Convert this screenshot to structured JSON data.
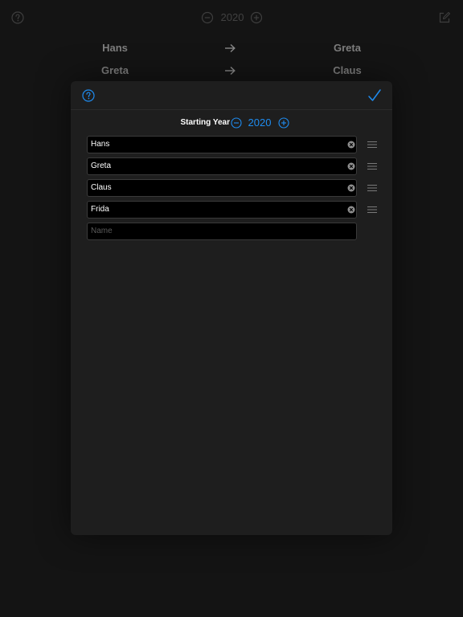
{
  "colors": {
    "accent": "#1e8cf0",
    "sheet_background": "#1e1e1e",
    "field_background": "#000000",
    "dimmed_text": "#7d7d7d"
  },
  "background": {
    "toolbar": {
      "help_icon": "question-circle-icon",
      "decrement_icon": "minus-circle-icon",
      "year": "2020",
      "increment_icon": "plus-circle-icon",
      "edit_icon": "compose-icon"
    },
    "pairs": [
      {
        "giver": "Hans",
        "receiver": "Greta"
      },
      {
        "giver": "Greta",
        "receiver": "Claus"
      }
    ],
    "arrow_icon": "arrow-right-icon"
  },
  "sheet": {
    "help_icon": "question-circle-icon",
    "done_icon": "checkmark-icon",
    "starting_year": {
      "label": "Starting Year",
      "value": "2020",
      "decrement_icon": "minus-circle-icon",
      "increment_icon": "plus-circle-icon"
    },
    "names": [
      {
        "value": "Hans"
      },
      {
        "value": "Greta"
      },
      {
        "value": "Claus"
      },
      {
        "value": "Frida"
      }
    ],
    "new_name": {
      "value": "",
      "placeholder": "Name"
    },
    "clear_icon": "clear-x-circle-icon",
    "reorder_icon": "drag-handle-icon"
  }
}
